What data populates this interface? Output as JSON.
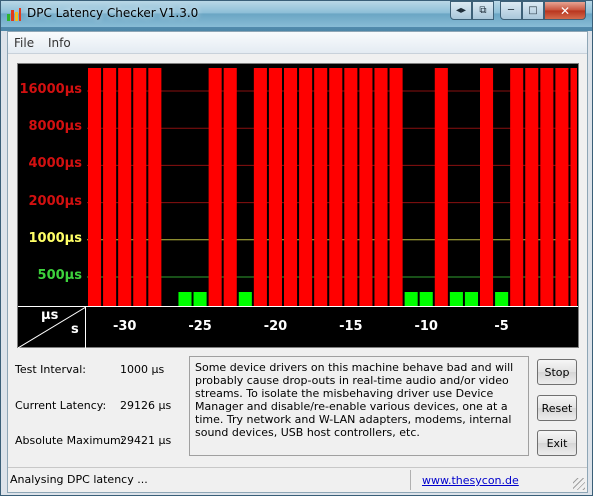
{
  "window": {
    "title": "DPC Latency Checker V1.3.0",
    "buttons": {
      "min": "▭",
      "max": "▢",
      "close": "✕",
      "extra1": "⌫",
      "extra2": "⇱"
    }
  },
  "menu": {
    "file": "File",
    "info": "Info"
  },
  "colors": {
    "bar_red": "#ff0000",
    "bar_green": "#00ff00",
    "label_red": "#d21010",
    "label_yellow": "#ffff66",
    "label_green": "#3dd23d"
  },
  "chart_data": {
    "type": "bar",
    "ylabel_unit": "µs",
    "xlabel_unit": "s",
    "y_labels": [
      {
        "text": "16000µs",
        "value": 16000,
        "color": "red"
      },
      {
        "text": "8000µs",
        "value": 8000,
        "color": "red"
      },
      {
        "text": "4000µs",
        "value": 4000,
        "color": "red"
      },
      {
        "text": "2000µs",
        "value": 2000,
        "color": "red"
      },
      {
        "text": "1000µs",
        "value": 1000,
        "color": "yellow"
      },
      {
        "text": "500µs",
        "value": 500,
        "color": "green"
      }
    ],
    "x_ticks": [
      "-30",
      "-25",
      "-20",
      "-15",
      "-10",
      "-5"
    ],
    "x_tick_values": [
      -30,
      -25,
      -20,
      -15,
      -10,
      -5
    ],
    "x_range": [
      -32.5,
      0
    ],
    "bars": [
      {
        "t": -32,
        "status": "red"
      },
      {
        "t": -31,
        "status": "red"
      },
      {
        "t": -30,
        "status": "red"
      },
      {
        "t": -29,
        "status": "red"
      },
      {
        "t": -28,
        "status": "red"
      },
      {
        "t": -27,
        "status": "none"
      },
      {
        "t": -26,
        "status": "green"
      },
      {
        "t": -25,
        "status": "green"
      },
      {
        "t": -24,
        "status": "red"
      },
      {
        "t": -23,
        "status": "red"
      },
      {
        "t": -22,
        "status": "green"
      },
      {
        "t": -21,
        "status": "red"
      },
      {
        "t": -20,
        "status": "red"
      },
      {
        "t": -19,
        "status": "red"
      },
      {
        "t": -18,
        "status": "red"
      },
      {
        "t": -17,
        "status": "red"
      },
      {
        "t": -16,
        "status": "red"
      },
      {
        "t": -15,
        "status": "red"
      },
      {
        "t": -14,
        "status": "red"
      },
      {
        "t": -13,
        "status": "red"
      },
      {
        "t": -12,
        "status": "red"
      },
      {
        "t": -11,
        "status": "green"
      },
      {
        "t": -10,
        "status": "green"
      },
      {
        "t": -9,
        "status": "red"
      },
      {
        "t": -8,
        "status": "green"
      },
      {
        "t": -7,
        "status": "green"
      },
      {
        "t": -6,
        "status": "red"
      },
      {
        "t": -5,
        "status": "green"
      },
      {
        "t": -4,
        "status": "red"
      },
      {
        "t": -3,
        "status": "red"
      },
      {
        "t": -2,
        "status": "red"
      },
      {
        "t": -1,
        "status": "red"
      },
      {
        "t": 0,
        "status": "red"
      }
    ]
  },
  "info": {
    "test_interval_label": "Test Interval:",
    "test_interval_value": "1000 µs",
    "current_latency_label": "Current Latency:",
    "current_latency_value": "29126 µs",
    "absolute_max_label": "Absolute Maximum:",
    "absolute_max_value": "29421 µs"
  },
  "message": "Some device drivers on this machine behave bad and will probably cause drop-outs in real-time audio and/or video streams. To isolate the misbehaving driver use Device Manager and disable/re-enable various devices, one at a time. Try network and W-LAN adapters, modems, internal sound devices, USB host controllers, etc.",
  "buttons": {
    "stop": "Stop",
    "reset": "Reset",
    "exit": "Exit"
  },
  "status": {
    "text": "Analysing DPC latency ...",
    "link": "www.thesycon.de"
  }
}
